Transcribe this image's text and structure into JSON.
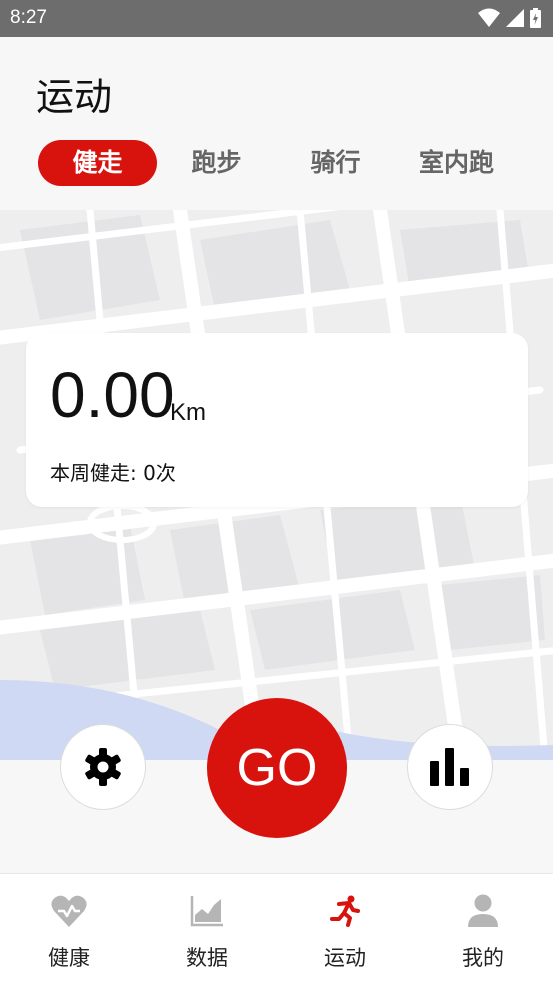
{
  "status_bar": {
    "time": "8:27"
  },
  "page": {
    "title": "运动"
  },
  "tabs": [
    {
      "label": "健走",
      "active": true
    },
    {
      "label": "跑步",
      "active": false
    },
    {
      "label": "骑行",
      "active": false
    },
    {
      "label": "室内跑",
      "active": false
    }
  ],
  "stats": {
    "distance": "0.00",
    "unit": "Km",
    "weekly": "本周健走: 0次"
  },
  "actions": {
    "go_label": "GO",
    "settings_icon": "gear-icon",
    "stats_icon": "bar-chart-icon"
  },
  "nav": [
    {
      "label": "健康",
      "icon": "heart-icon",
      "active": false
    },
    {
      "label": "数据",
      "icon": "area-chart-icon",
      "active": false
    },
    {
      "label": "运动",
      "icon": "runner-icon",
      "active": true
    },
    {
      "label": "我的",
      "icon": "person-icon",
      "active": false
    }
  ],
  "colors": {
    "accent": "#d8120d",
    "status_bar": "#6d6d6d",
    "inactive_icon": "#b5b5b5"
  }
}
